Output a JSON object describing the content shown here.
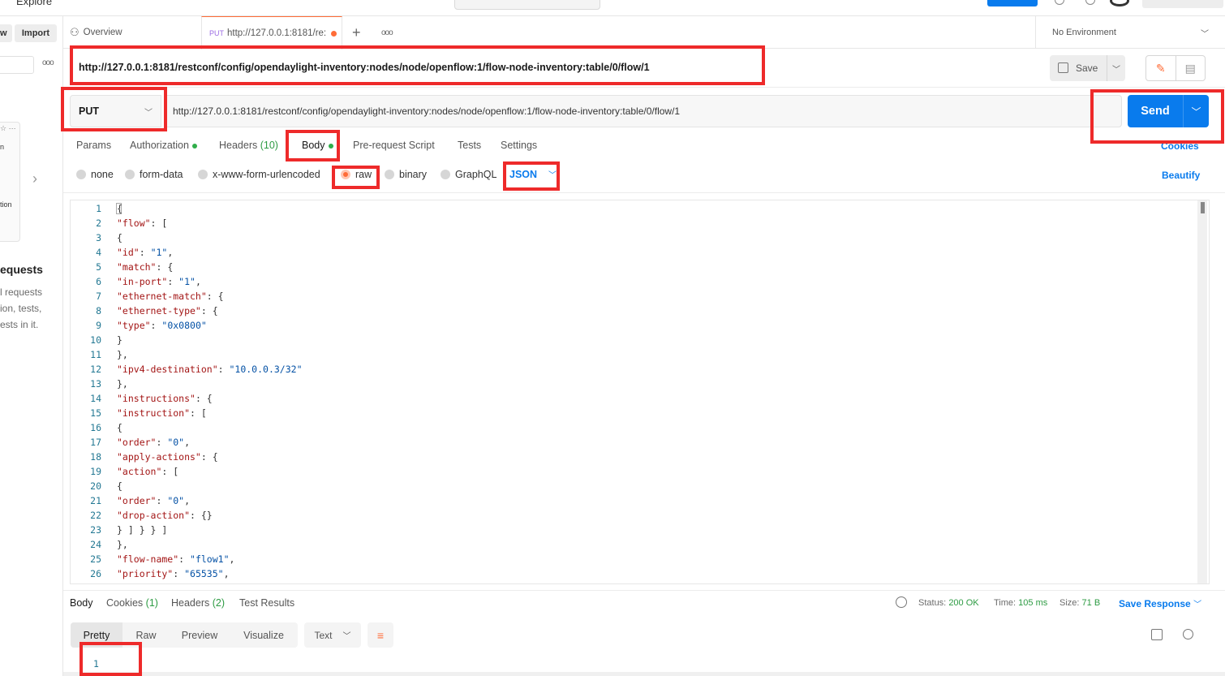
{
  "topbar": {
    "explore": "Explore"
  },
  "sidebar": {
    "new_label": "w",
    "import_label": "Import",
    "more": "ooo",
    "card_top": "☆ ···",
    "card_a": "n",
    "card_b": "tion",
    "heading": "equests",
    "desc_lines": [
      "l requests",
      "ion, tests,",
      "ests in it."
    ]
  },
  "tabs": {
    "overview_label": "Overview",
    "active_method": "PUT",
    "active_label": "http://127.0.0.1:8181/re:",
    "new_tab": "+",
    "more": "ooo",
    "environment": "No Environment"
  },
  "header": {
    "title": "http://127.0.0.1:8181/restconf/config/opendaylight-inventory:nodes/node/openflow:1/flow-node-inventory:table/0/flow/1",
    "save_label": "Save"
  },
  "request": {
    "method": "PUT",
    "url": "http://127.0.0.1:8181/restconf/config/opendaylight-inventory:nodes/node/openflow:1/flow-node-inventory:table/0/flow/1",
    "send_label": "Send"
  },
  "subtabs": {
    "params": "Params",
    "authorization": "Authorization",
    "headers": "Headers",
    "headers_count": "(10)",
    "body": "Body",
    "prerequest": "Pre-request Script",
    "tests": "Tests",
    "settings": "Settings",
    "cookies": "Cookies"
  },
  "body_types": {
    "none": "none",
    "form_data": "form-data",
    "urlencoded": "x-www-form-urlencoded",
    "raw": "raw",
    "binary": "binary",
    "graphql": "GraphQL",
    "format": "JSON",
    "beautify": "Beautify"
  },
  "editor": {
    "lines": [
      "{",
      "\"flow\": [",
      "{",
      "\"id\": \"1\",",
      "\"match\": {",
      "\"in-port\": \"1\",",
      "\"ethernet-match\": {",
      "\"ethernet-type\": {",
      "\"type\": \"0x0800\"",
      "}",
      "},",
      "\"ipv4-destination\": \"10.0.0.3/32\"",
      "},",
      "\"instructions\": {",
      "\"instruction\": [",
      "{",
      "\"order\": \"0\",",
      "\"apply-actions\": {",
      "\"action\": [",
      "{",
      "\"order\": \"0\",",
      "\"drop-action\": {}",
      "} ] } } ]",
      "},",
      "\"flow-name\": \"flow1\",",
      "\"priority\": \"65535\","
    ]
  },
  "response": {
    "tabs": {
      "body": "Body",
      "cookies": "Cookies",
      "cookies_count": "(1)",
      "headers": "Headers",
      "headers_count": "(2)",
      "test_results": "Test Results"
    },
    "status_label": "Status:",
    "status_value": "200 OK",
    "time_label": "Time:",
    "time_value": "105 ms",
    "size_label": "Size:",
    "size_value": "71 B",
    "save_response": "Save Response",
    "views": [
      "Pretty",
      "Raw",
      "Preview",
      "Visualize"
    ],
    "text_format": "Text",
    "first_line": "1"
  }
}
